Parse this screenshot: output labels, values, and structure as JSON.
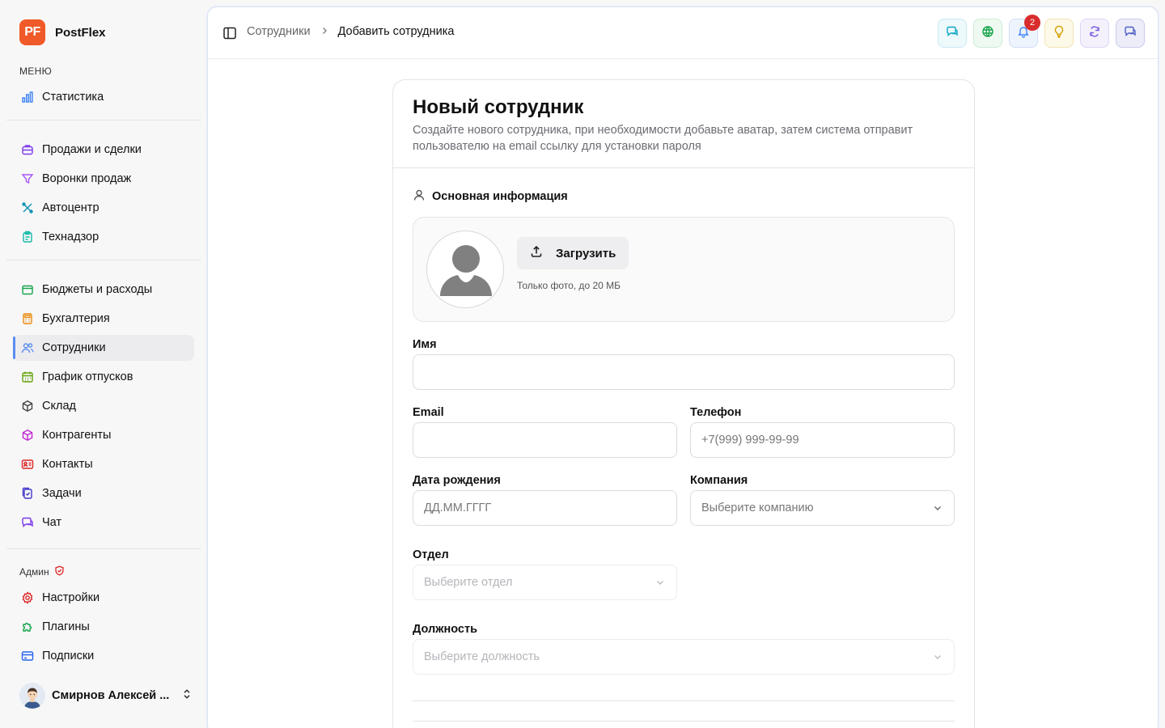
{
  "app": {
    "logo_initials": "PF",
    "name": "PostFlex"
  },
  "sidebar": {
    "menu_caption": "МЕНЮ",
    "admin_caption": "Админ",
    "items": [
      {
        "label": "Статистика",
        "icon": "bar-chart-icon"
      },
      {
        "label": "Продажи и сделки",
        "icon": "briefcase-icon"
      },
      {
        "label": "Воронки продаж",
        "icon": "funnel-icon"
      },
      {
        "label": "Автоцентр",
        "icon": "wrench-icon"
      },
      {
        "label": "Технадзор",
        "icon": "clipboard-icon"
      },
      {
        "label": "Бюджеты и расходы",
        "icon": "wallet-icon"
      },
      {
        "label": "Бухгалтерия",
        "icon": "calculator-icon"
      },
      {
        "label": "Сотрудники",
        "icon": "users-icon",
        "active": true
      },
      {
        "label": "График отпусков",
        "icon": "calendar-icon"
      },
      {
        "label": "Склад",
        "icon": "box-icon"
      },
      {
        "label": "Контрагенты",
        "icon": "package-icon"
      },
      {
        "label": "Контакты",
        "icon": "contact-card-icon"
      },
      {
        "label": "Задачи",
        "icon": "tasks-icon"
      },
      {
        "label": "Чат",
        "icon": "chat-icon"
      }
    ],
    "admin_items": [
      {
        "label": "Настройки",
        "icon": "settings-icon"
      },
      {
        "label": "Плагины",
        "icon": "puzzle-icon"
      },
      {
        "label": "Подписки",
        "icon": "credit-card-icon"
      }
    ],
    "user": {
      "name": "Смирнов Алексей ..."
    }
  },
  "header": {
    "breadcrumb": {
      "parent": "Сотрудники",
      "current": "Добавить сотрудника"
    },
    "actions": [
      {
        "icon": "chat-icon",
        "color": "#0ea5c6",
        "bg": "#eef9fc",
        "border": "#c9e9f2"
      },
      {
        "icon": "network-icon",
        "color": "#16a34a",
        "bg": "#eefaf1",
        "border": "#cdebd6"
      },
      {
        "icon": "bell-icon",
        "color": "#3b82f6",
        "bg": "#eef4fd",
        "border": "#cfdef6",
        "badge": "2"
      },
      {
        "icon": "lightbulb-icon",
        "color": "#d4a106",
        "bg": "#fdf9e9",
        "border": "#f1e4b0"
      },
      {
        "icon": "refresh-icon",
        "color": "#7c5ce0",
        "bg": "#f4f1fd",
        "border": "#ddd5f6"
      },
      {
        "icon": "chat-bubbles-icon",
        "color": "#4f5fc4",
        "bg": "#ecedf8",
        "border": "#c9cdec"
      }
    ]
  },
  "form": {
    "title": "Новый сотрудник",
    "description": "Создайте нового сотрудника, при необходимости добавьте аватар, затем система отправит пользователю на email ссылку для установки пароля",
    "section_title": "Основная информация",
    "upload": {
      "button_label": "Загрузить",
      "hint": "Только фото, до 20 МБ"
    },
    "fields": {
      "name": {
        "label": "Имя",
        "value": "",
        "placeholder": ""
      },
      "email": {
        "label": "Email",
        "value": "",
        "placeholder": ""
      },
      "phone": {
        "label": "Телефон",
        "value": "",
        "placeholder": "+7(999) 999-99-99"
      },
      "birthdate": {
        "label": "Дата рождения",
        "value": "",
        "placeholder": "ДД.ММ.ГГГГ"
      },
      "company": {
        "label": "Компания",
        "placeholder": "Выберите компанию"
      },
      "department": {
        "label": "Отдел",
        "placeholder": "Выберите отдел"
      },
      "position": {
        "label": "Должность",
        "placeholder": "Выберите должность"
      }
    }
  }
}
